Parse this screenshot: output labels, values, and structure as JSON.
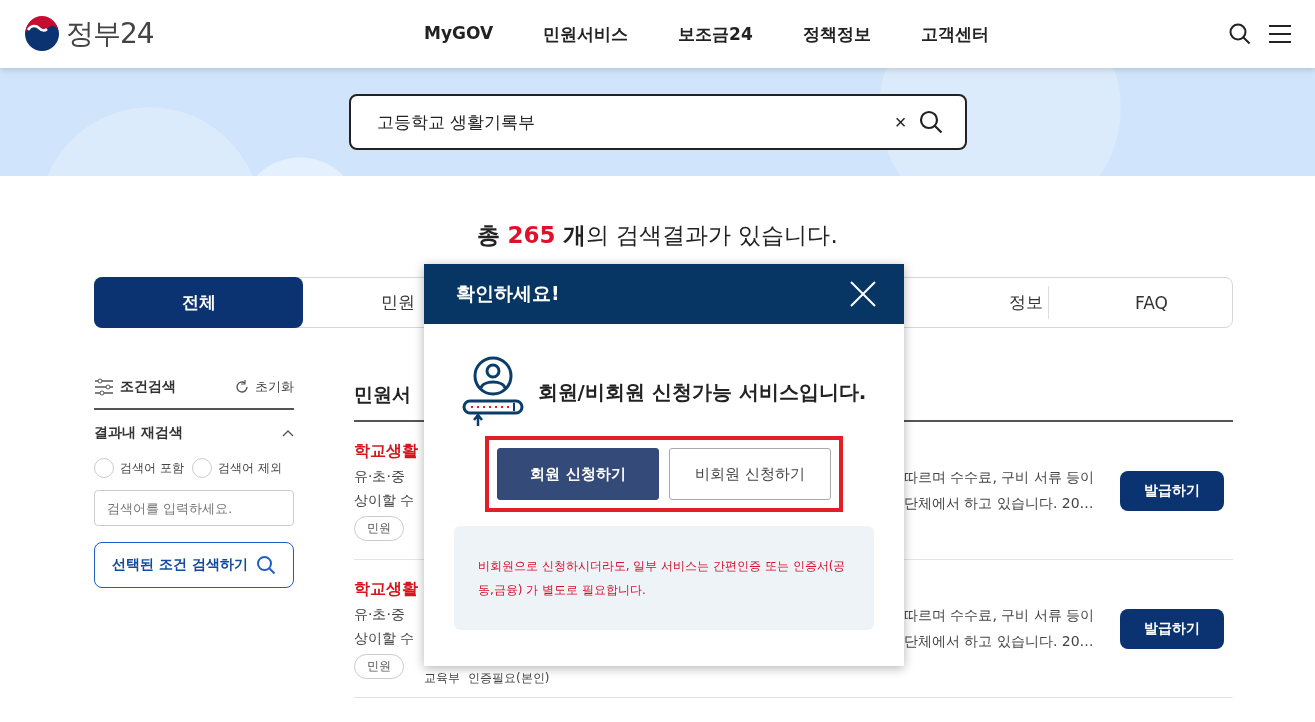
{
  "header": {
    "logo_text": "정부24",
    "nav": [
      {
        "label": "MyGOV"
      },
      {
        "label": "민원서비스"
      },
      {
        "label": "보조금24"
      },
      {
        "label": "정책정보"
      },
      {
        "label": "고객센터"
      }
    ]
  },
  "search": {
    "value": "고등학교 생활기록부",
    "clear": "×"
  },
  "result_summary": {
    "before": "총",
    "count": "265",
    "after": "**개**의 검색결과가 있습니다."
  },
  "tabs": [
    {
      "label": "전체",
      "selected": true
    },
    {
      "label": "민원",
      "selected": false
    },
    {
      "label": "정보",
      "selected": false
    },
    {
      "label": "FAQ",
      "selected": false
    }
  ],
  "filter": {
    "title": "조건검색",
    "reset": "초기화",
    "section": {
      "title": "결과내 재검색",
      "expanded": true
    },
    "options": [
      {
        "label": "검색어 포함",
        "selected": false
      },
      {
        "label": "검색어 제외",
        "selected": false
      }
    ],
    "placeholder": "검색어를 입력하세요.",
    "button": "선택된 조건 검색하기"
  },
  "results": {
    "heading": "민원서",
    "rows": [
      {
        "title": "학교생활",
        "left_lines": [
          "유·초·중",
          "상이할 수"
        ],
        "right_lines": [
          "따르며 수수료, 구비 서류 등이",
          "단체에서 하고 있습니다. 20…"
        ],
        "chip": "민원",
        "meta": [],
        "button": "발급하기"
      },
      {
        "title": "학교생활",
        "left_lines": [
          "유·초·중",
          "상이할 수"
        ],
        "right_lines": [
          "따르며 수수료, 구비 서류 등이",
          "단체에서 하고 있습니다. 20…"
        ],
        "chip": "민원",
        "meta": [
          "교육부",
          "인증필요(본인)"
        ],
        "button": "발급하기"
      }
    ]
  },
  "modal": {
    "title": "확인하세요!",
    "message": "회원/비회원 신청가능 서비스입니다.",
    "highlighted": true,
    "buttons": [
      {
        "label": "회원 신청하기",
        "kind": "primary"
      },
      {
        "label": "비회원 신청하기",
        "kind": "secondary"
      }
    ],
    "notice": "비회원으로 신청하시더라도, 일부 서비스는 간편인증 또는 인증서(공동,금융) 가 별도로 필요합니다."
  }
}
